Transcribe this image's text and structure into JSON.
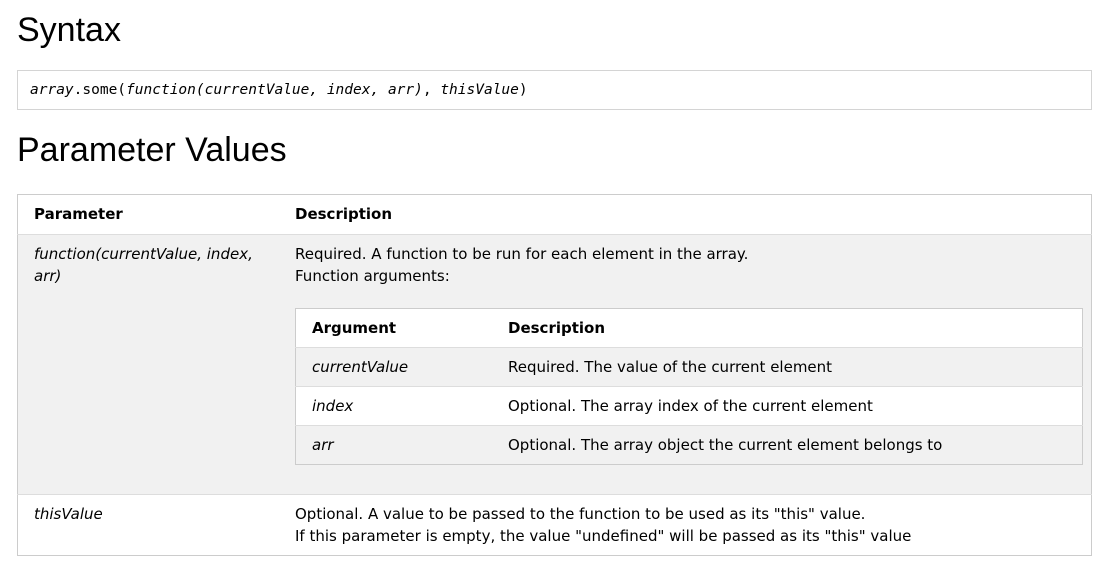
{
  "syntax": {
    "heading": "Syntax",
    "code": {
      "object": "array",
      "method": ".some(",
      "callback": "function(currentValue, index, arr)",
      "separator": ", ",
      "this_arg": "thisValue",
      "close": ")"
    }
  },
  "parameters": {
    "heading": "Parameter Values",
    "headers": {
      "parameter": "Parameter",
      "description": "Description"
    },
    "rows": [
      {
        "name": "function(currentValue, index, arr)",
        "description_lines": [
          "Required. A function to be run for each element in the array.",
          "Function arguments:"
        ],
        "arguments": {
          "headers": {
            "argument": "Argument",
            "description": "Description"
          },
          "rows": [
            {
              "name": "currentValue",
              "description": "Required. The value of the current element"
            },
            {
              "name": "index",
              "description": "Optional. The array index of the current element"
            },
            {
              "name": "arr",
              "description": "Optional. The array object the current element belongs to"
            }
          ]
        }
      },
      {
        "name": "thisValue",
        "description_lines": [
          "Optional. A value to be passed to the function to be used as its \"this\" value.",
          "If this parameter is empty, the value \"undefined\" will be passed as its \"this\" value"
        ]
      }
    ]
  },
  "colors": {
    "row_shade": "#f1f1f1",
    "border": "#cccccc",
    "divider": "#dddddd"
  }
}
